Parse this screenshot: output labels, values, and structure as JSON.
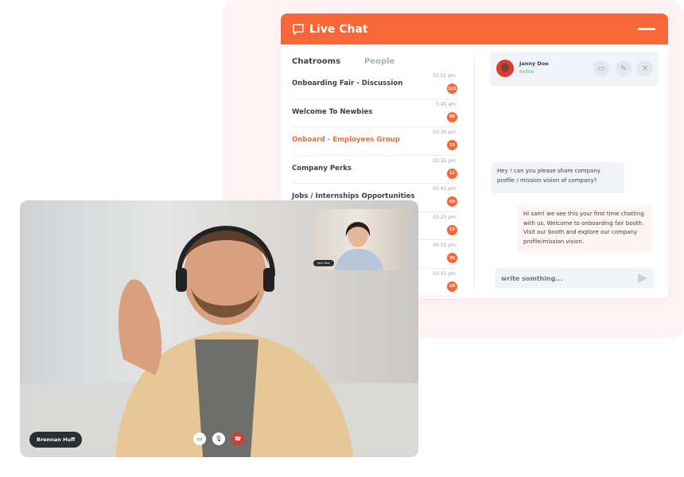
{
  "chat": {
    "title": "Live Chat",
    "icons": {
      "chat": "chat-bubble-icon",
      "minimize": "minimize-icon"
    },
    "tabs": [
      "Chatrooms",
      "People"
    ],
    "rooms": [
      {
        "name": "Onboarding Fair - Discussion",
        "time": "02:51 pm",
        "count": "105"
      },
      {
        "name": "Welcome To Newbies",
        "time": "5:45 am",
        "count": "66"
      },
      {
        "name": "Onboard - Employees Group",
        "time": "03:36 pm",
        "count": "23",
        "active": true
      },
      {
        "name": "Company Perks",
        "time": "02:31 pm",
        "count": "12"
      },
      {
        "name": "Jobs / Internships Opportunities",
        "time": "01:41 pm",
        "count": "09"
      },
      {
        "name": "",
        "time": "02:25 pm",
        "count": "15"
      },
      {
        "name": "",
        "time": "06:51 pm",
        "count": "36"
      },
      {
        "name": "",
        "time": "02:51 pm",
        "count": "28"
      }
    ],
    "contact": {
      "name": "Janny Doe",
      "status": "online"
    },
    "messages": [
      {
        "from": "user",
        "text": "Hey ! can you please share company profile / mission vision of company?"
      },
      {
        "from": "agent",
        "text": "Hi sam! we see this your first time chatting with us. Welcome to onboarding fair booth. Visit our booth and explore our company profile/mission vision."
      }
    ],
    "input_placeholder": "write somthing...",
    "accent": "#f96736"
  },
  "video": {
    "caller_name": "Brennan Huff",
    "pip_name": "Jane Doe",
    "controls": [
      "video-camera-icon",
      "microphone-icon",
      "hang-up-icon"
    ]
  }
}
